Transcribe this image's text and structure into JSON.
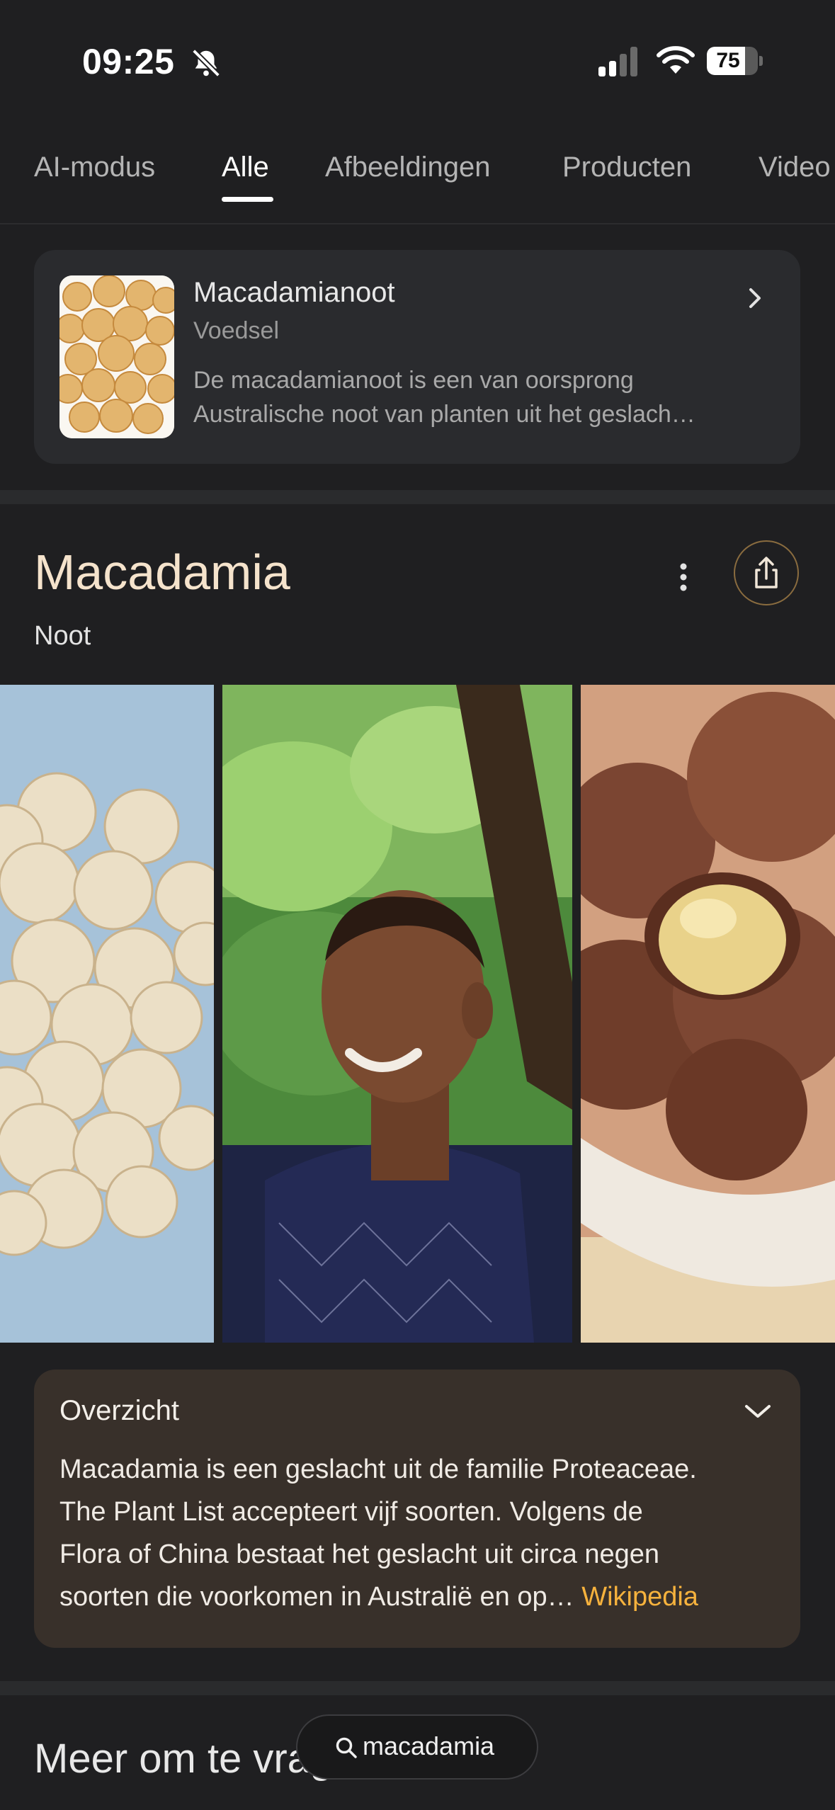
{
  "status_bar": {
    "time": "09:25",
    "silent_icon": "bell-slash-icon",
    "signal_icon": "cellular-signal-icon",
    "wifi_icon": "wifi-icon",
    "battery_percent": "75",
    "battery_level": 0.75
  },
  "tabs": [
    {
      "label": "AI-modus",
      "active": false
    },
    {
      "label": "Alle",
      "active": true
    },
    {
      "label": "Afbeeldingen",
      "active": false
    },
    {
      "label": "Producten",
      "active": false
    },
    {
      "label": "Video",
      "active": false
    }
  ],
  "knowledge_card": {
    "title": "Macadamianoot",
    "subtitle": "Voedsel",
    "description_line1": "De macadamianoot is een van oorsprong",
    "description_line2": "Australische noot van planten uit het geslach…",
    "chevron_icon": "chevron-right-icon"
  },
  "entity": {
    "title": "Macadamia",
    "subtitle": "Noot",
    "more_icon": "more-vert-icon",
    "share_icon": "share-icon"
  },
  "images": [
    {
      "description": "macadamia-nuts-photo"
    },
    {
      "description": "farmer-portrait-photo"
    },
    {
      "description": "macadamia-in-shell-photo"
    }
  ],
  "overview": {
    "title": "Overzicht",
    "line1": "Macadamia is een geslacht uit de familie Proteaceae.",
    "line2": "The Plant List accepteert vijf soorten. Volgens de",
    "line3": "Flora of China bestaat het geslacht uit circa negen",
    "line4": "soorten die voorkomen in Australië en op…",
    "source": "Wikipedia",
    "accent_color": "#f6b23d"
  },
  "more_section": {
    "title": "Meer om te vragen"
  },
  "search_pill": {
    "query": "macadamia",
    "icon": "search-icon"
  }
}
